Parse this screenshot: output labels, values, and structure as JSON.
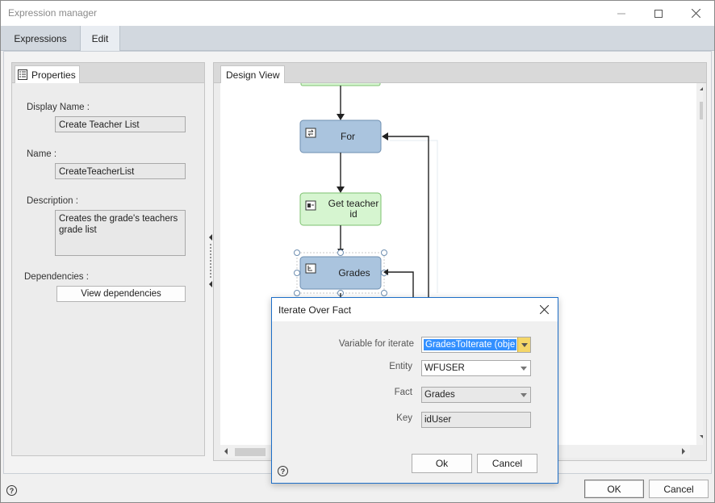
{
  "window": {
    "title": "Expression manager"
  },
  "tabs": [
    {
      "label": "Expressions",
      "active": false
    },
    {
      "label": "Edit",
      "active": true
    }
  ],
  "properties": {
    "tab_label": "Properties",
    "display_name_label": "Display Name :",
    "display_name_value": "Create Teacher List",
    "name_label": "Name :",
    "name_value": "CreateTeacherList",
    "description_label": "Description :",
    "description_value": "Creates the grade's teachers grade list",
    "dependencies_label": "Dependencies :",
    "view_dependencies_label": "View dependencies"
  },
  "design_view": {
    "tab_label": "Design View",
    "nodes": [
      {
        "label": "For",
        "kind": "loop"
      },
      {
        "label": "Get teacher id",
        "kind": "action"
      },
      {
        "label": "Grades",
        "kind": "iterate-fact"
      }
    ]
  },
  "footer": {
    "ok_label": "OK",
    "cancel_label": "Cancel"
  },
  "dialog": {
    "title": "Iterate Over Fact",
    "variable_label": "Variable for iterate",
    "variable_value": "GradesToIterate (obje",
    "entity_label": "Entity",
    "entity_value": "WFUSER",
    "fact_label": "Fact",
    "fact_value": "Grades",
    "key_label": "Key",
    "key_value": "idUser",
    "ok_label": "Ok",
    "cancel_label": "Cancel"
  },
  "colors": {
    "accent_blue": "#1e6fc8",
    "node_blue": "#aac4de",
    "node_green": "#d6f5d0",
    "selection_highlight": "#3390ff",
    "dropdown_yellow": "#f4d668"
  },
  "icons": [
    "minimize-icon",
    "maximize-icon",
    "close-icon",
    "properties-icon",
    "help-icon",
    "loop-icon",
    "action-icon",
    "iterate-icon",
    "chevron-down-icon"
  ]
}
